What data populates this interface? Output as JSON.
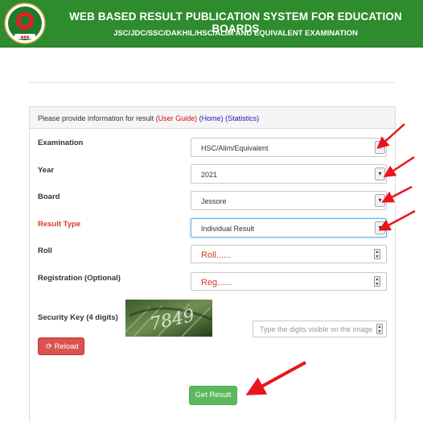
{
  "header": {
    "title": "WEB BASED RESULT PUBLICATION SYSTEM FOR EDUCATION BOARDS",
    "subtitle": "JSC/JDC/SSC/DAKHIL/HSC/ALIM AND EQUIVALENT EXAMINATION"
  },
  "panel": {
    "intro": "Please provide information for result",
    "user_guide": "(User Guide)",
    "home": "(Home)",
    "statistics": "(Statistics)"
  },
  "form": {
    "examination": {
      "label": "Examination",
      "value": "HSC/Alim/Equivalent"
    },
    "year": {
      "label": "Year",
      "value": "2021"
    },
    "board": {
      "label": "Board",
      "value": "Jessore"
    },
    "result_type": {
      "label": "Result Type",
      "value": "Individual Result"
    },
    "roll": {
      "label": "Roll",
      "value": "Roll......"
    },
    "registration": {
      "label": "Registration (Optional)",
      "value": "Reg......"
    },
    "security_key": {
      "label": "Security Key (4 digits)",
      "placeholder": "Type the digits visible on the image"
    }
  },
  "captcha_text": "7849",
  "buttons": {
    "reload": "Reload",
    "get_result": "Get Result"
  },
  "colors": {
    "header_bg": "#2e8b2e",
    "annotation_arrow": "#e8151b",
    "reload_btn": "#d9534f",
    "get_result_btn": "#5cb85c"
  }
}
